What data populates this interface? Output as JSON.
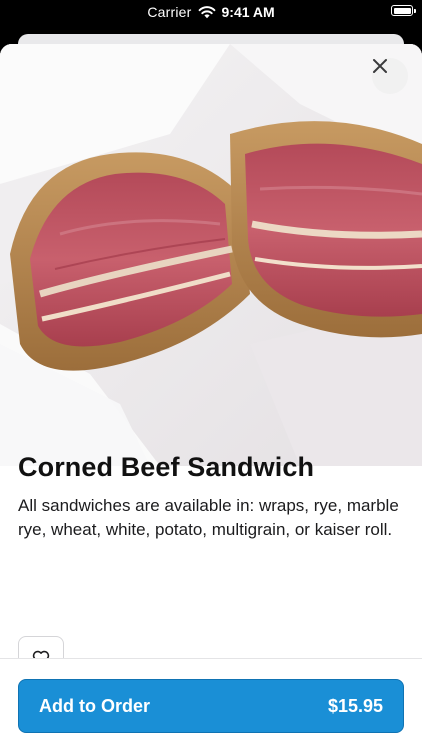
{
  "status_bar": {
    "carrier": "Carrier",
    "time": "9:41 AM"
  },
  "item": {
    "name": "Corned Beef Sandwich",
    "description": "All sandwiches are available in: wraps, rye, marble rye, wheat, white, potato, multigrain, or kaiser roll."
  },
  "actions": {
    "add_label": "Add to Order",
    "price": "$15.95"
  },
  "icons": {
    "close": "close-icon",
    "favorite": "heart-icon"
  },
  "colors": {
    "accent": "#1a8fd6"
  }
}
